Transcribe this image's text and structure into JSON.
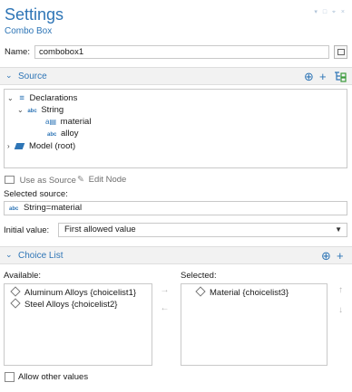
{
  "header": {
    "title": "Settings",
    "subtitle": "Combo Box",
    "window_controls": "▾ □ ⌖ ×"
  },
  "name": {
    "label": "Name:",
    "value": "combobox1"
  },
  "source": {
    "title": "Source",
    "tree": {
      "declarations": "Declarations",
      "string": "String",
      "material": "material",
      "alloy": "alloy",
      "model": "Model (root)"
    },
    "use_as_source": "Use as Source",
    "edit_node": "Edit Node",
    "selected_source_label": "Selected source:",
    "selected_source_value": "String=material",
    "initial_value_label": "Initial value:",
    "initial_value": "First allowed value"
  },
  "choice_list": {
    "title": "Choice List",
    "available_label": "Available:",
    "selected_label": "Selected:",
    "available": [
      "Aluminum Alloys {choicelist1}",
      "Steel Alloys {choicelist2}"
    ],
    "selected": [
      "Material {choicelist3}"
    ]
  },
  "allow_other_values": "Allow other values",
  "icons": {
    "add_circle": "⊕",
    "add_plus": "+",
    "abc_tag": "abc"
  },
  "colors": {
    "accent": "#2e75b6",
    "section_bg": "#f2f2f2"
  }
}
